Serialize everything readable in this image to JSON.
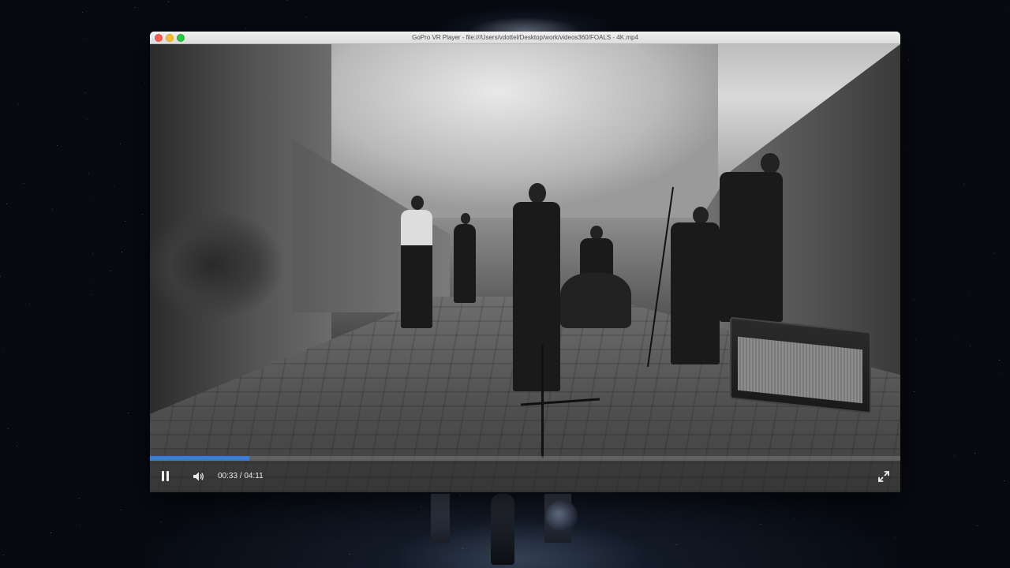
{
  "window": {
    "title": "GoPro VR Player - file:///Users/vdottel/Desktop/work/videos360/FOALS - 4K.mp4"
  },
  "player": {
    "state": "playing",
    "progress_fraction": 0.132,
    "current_time": "00:33",
    "duration": "04:11",
    "time_separator": " / ",
    "accent_color": "#3a7dd8"
  },
  "icons": {
    "play_pause": "pause-icon",
    "volume": "volume-icon",
    "fullscreen": "fullscreen-icon"
  }
}
